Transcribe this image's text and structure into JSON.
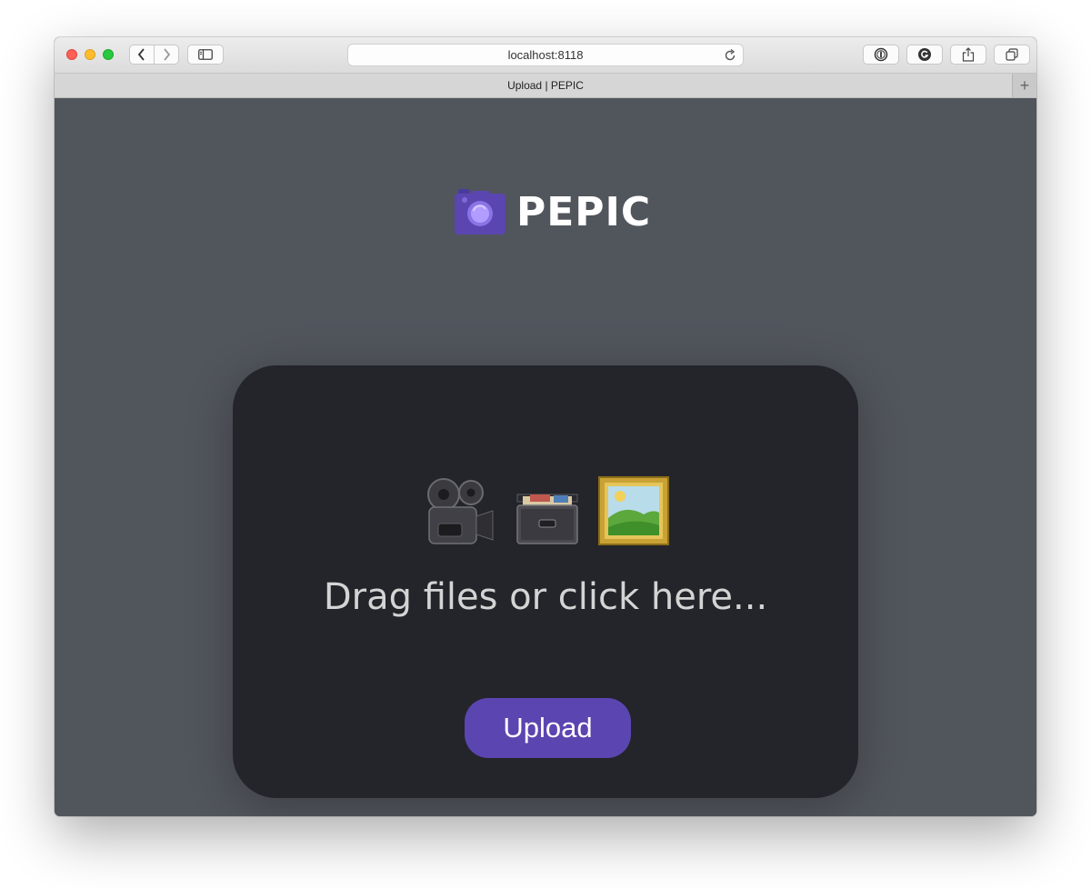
{
  "browser": {
    "url": "localhost:8118",
    "tab_title": "Upload | PEPIC",
    "new_tab_label": "+"
  },
  "app": {
    "logo_text": "PEPIC",
    "logo_icon": "camera-icon",
    "brand_color": "#5b45b0"
  },
  "dropzone": {
    "icons": [
      "movie-camera-icon",
      "card-file-box-icon",
      "framed-picture-icon"
    ],
    "prompt": "Drag files or click here...",
    "upload_label": "Upload"
  },
  "colors": {
    "page_background": "#51555c",
    "dropzone_background": "#23252a",
    "button": "#5b45b0"
  }
}
